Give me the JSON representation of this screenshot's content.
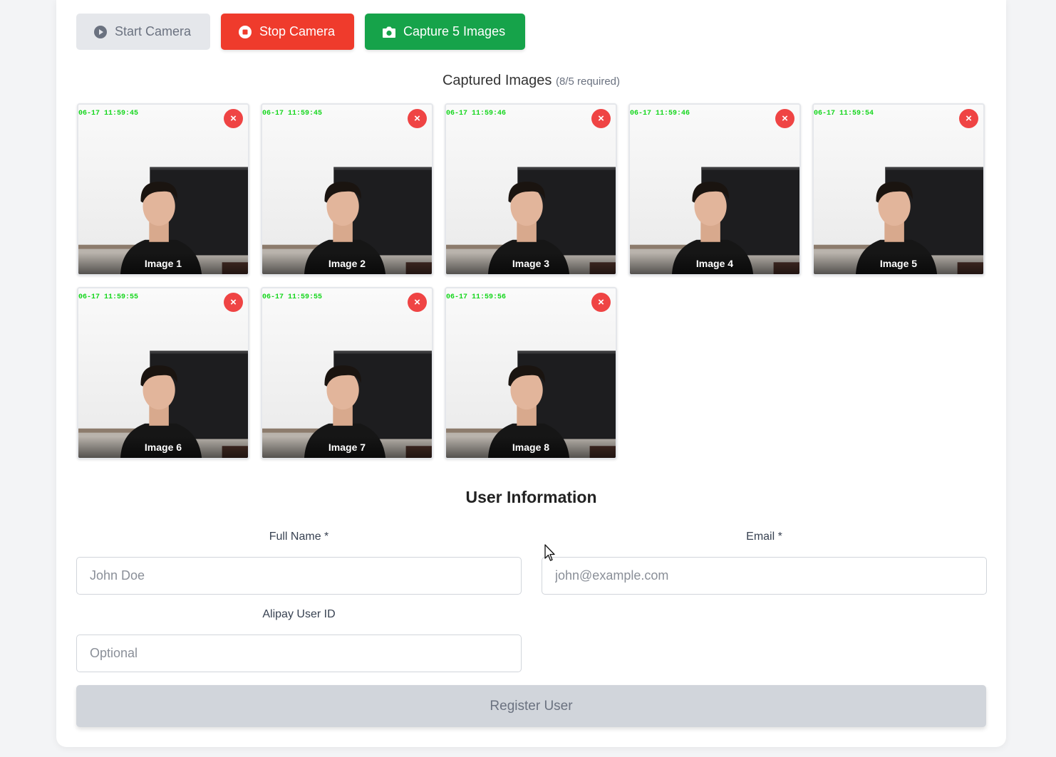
{
  "controls": {
    "start_label": "Start Camera",
    "stop_label": "Stop Camera",
    "capture_label": "Capture 5 Images"
  },
  "captured": {
    "title": "Captured Images",
    "count_text": "(8/5 required)",
    "remove_glyph": "×",
    "images": [
      {
        "label": "Image 1",
        "timestamp": "06-17 11:59:45"
      },
      {
        "label": "Image 2",
        "timestamp": "06-17 11:59:45"
      },
      {
        "label": "Image 3",
        "timestamp": "06-17 11:59:46"
      },
      {
        "label": "Image 4",
        "timestamp": "06-17 11:59:46"
      },
      {
        "label": "Image 5",
        "timestamp": "06-17 11:59:54"
      },
      {
        "label": "Image 6",
        "timestamp": "06-17 11:59:55"
      },
      {
        "label": "Image 7",
        "timestamp": "06-17 11:59:55"
      },
      {
        "label": "Image 8",
        "timestamp": "06-17 11:59:56"
      }
    ]
  },
  "user_info": {
    "title": "User Information",
    "full_name_label": "Full Name *",
    "full_name_placeholder": "John Doe",
    "email_label": "Email *",
    "email_placeholder": "john@example.com",
    "alipay_label": "Alipay User ID",
    "alipay_placeholder": "Optional"
  },
  "register_label": "Register User",
  "colors": {
    "stop": "#ef3b2c",
    "capture": "#16a34a",
    "remove": "#ef4444",
    "timestamp": "#12d61a",
    "register_disabled": "#d1d5db"
  },
  "icons": {
    "start": "play-circle-icon",
    "stop": "stop-circle-icon",
    "capture": "camera-icon",
    "remove": "close-icon"
  }
}
